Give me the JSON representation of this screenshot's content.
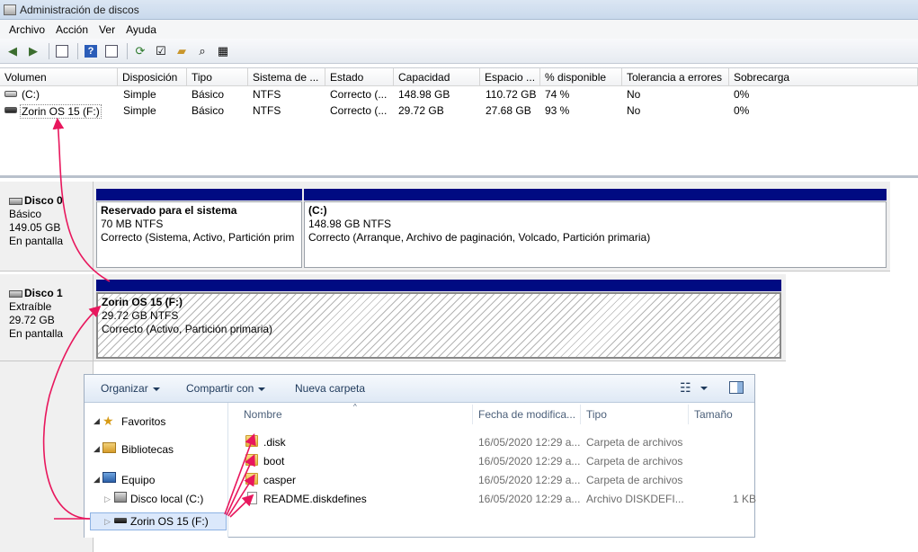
{
  "window": {
    "title": "Administración de discos"
  },
  "menu": [
    "Archivo",
    "Acción",
    "Ver",
    "Ayuda"
  ],
  "volumes": {
    "columns": [
      "Volumen",
      "Disposición",
      "Tipo",
      "Sistema de ...",
      "Estado",
      "Capacidad",
      "Espacio ...",
      "% disponible",
      "Tolerancia a errores",
      "Sobrecarga"
    ],
    "rows": [
      [
        "(C:)",
        "Simple",
        "Básico",
        "NTFS",
        "Correcto (...",
        "148.98 GB",
        "110.72 GB",
        "74 %",
        "No",
        "0%"
      ],
      [
        "Zorin OS 15 (F:)",
        "Simple",
        "Básico",
        "NTFS",
        "Correcto (...",
        "29.72 GB",
        "27.68 GB",
        "93 %",
        "No",
        "0%"
      ]
    ]
  },
  "disks": [
    {
      "name": "Disco 0",
      "kind": "Básico",
      "size": "149.05 GB",
      "status": "En pantalla",
      "partitions": [
        {
          "title": "Reservado para el sistema",
          "size": "70 MB NTFS",
          "state": "Correcto (Sistema, Activo, Partición prim"
        },
        {
          "title": "(C:)",
          "size": "148.98 GB NTFS",
          "state": "Correcto (Arranque, Archivo de paginación, Volcado, Partición primaria)"
        }
      ]
    },
    {
      "name": "Disco 1",
      "kind": "Extraíble",
      "size": "29.72 GB",
      "status": "En pantalla",
      "partitions": [
        {
          "title": "Zorin OS 15  (F:)",
          "size": "29.72 GB NTFS",
          "state": "Correcto (Activo, Partición primaria)"
        }
      ]
    }
  ],
  "explorer": {
    "toolbar": {
      "organize": "Organizar",
      "share": "Compartir con",
      "new_folder": "Nueva carpeta"
    },
    "nav": {
      "favorites": "Favoritos",
      "libraries": "Bibliotecas",
      "computer": "Equipo",
      "local_disk": "Disco local (C:)",
      "usb": "Zorin OS 15 (F:)"
    },
    "columns": {
      "name": "Nombre",
      "date": "Fecha de modifica...",
      "type": "Tipo",
      "size": "Tamaño"
    },
    "files": [
      {
        "name": ".disk",
        "date": "16/05/2020 12:29 a...",
        "type": "Carpeta de archivos",
        "size": ""
      },
      {
        "name": "boot",
        "date": "16/05/2020 12:29 a...",
        "type": "Carpeta de archivos",
        "size": ""
      },
      {
        "name": "casper",
        "date": "16/05/2020 12:29 a...",
        "type": "Carpeta de archivos",
        "size": ""
      },
      {
        "name": "README.diskdefines",
        "date": "16/05/2020 12:29 a...",
        "type": "Archivo DISKDEFI...",
        "size": "1 KB"
      }
    ]
  },
  "icons": [
    "back-arrow-icon",
    "forward-arrow-icon",
    "properties-icon",
    "help-icon",
    "refresh-icon",
    "folder-open-icon",
    "search-icon",
    "folder-icon",
    "file-icon",
    "star-icon",
    "library-icon",
    "computer-icon",
    "drive-icon",
    "usb-drive-icon"
  ],
  "colors": {
    "partition_bar": "#000b82",
    "annotation": "#e8175d",
    "selection": "#dbe8fb"
  }
}
